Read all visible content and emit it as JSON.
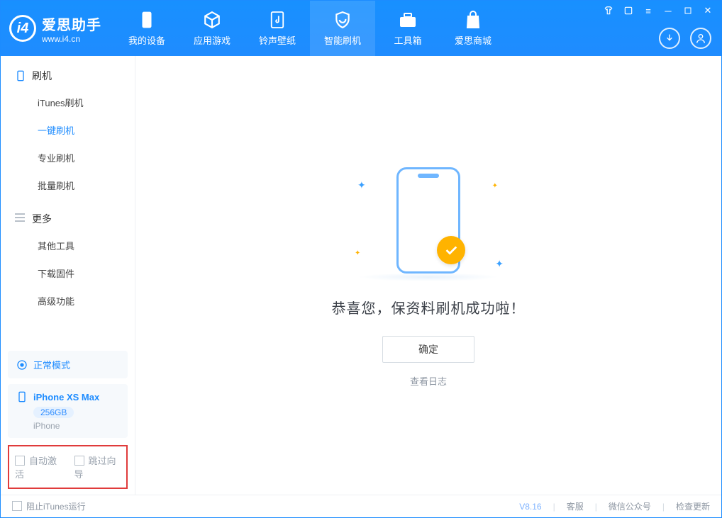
{
  "header": {
    "app_name": "爱思助手",
    "app_url": "www.i4.cn",
    "tabs": [
      {
        "label": "我的设备"
      },
      {
        "label": "应用游戏"
      },
      {
        "label": "铃声壁纸"
      },
      {
        "label": "智能刷机"
      },
      {
        "label": "工具箱"
      },
      {
        "label": "爱思商城"
      }
    ]
  },
  "sidebar": {
    "section1_title": "刷机",
    "items1": [
      {
        "label": "iTunes刷机"
      },
      {
        "label": "一键刷机"
      },
      {
        "label": "专业刷机"
      },
      {
        "label": "批量刷机"
      }
    ],
    "section2_title": "更多",
    "items2": [
      {
        "label": "其他工具"
      },
      {
        "label": "下载固件"
      },
      {
        "label": "高级功能"
      }
    ],
    "mode_label": "正常模式",
    "device_name": "iPhone XS Max",
    "device_storage": "256GB",
    "device_type": "iPhone",
    "opt_auto_activate": "自动激活",
    "opt_skip_guide": "跳过向导"
  },
  "main": {
    "success_text": "恭喜您，保资料刷机成功啦！",
    "ok_button": "确定",
    "view_log": "查看日志"
  },
  "footer": {
    "block_itunes": "阻止iTunes运行",
    "version": "V8.16",
    "support": "客服",
    "wechat": "微信公众号",
    "check_update": "检查更新"
  }
}
